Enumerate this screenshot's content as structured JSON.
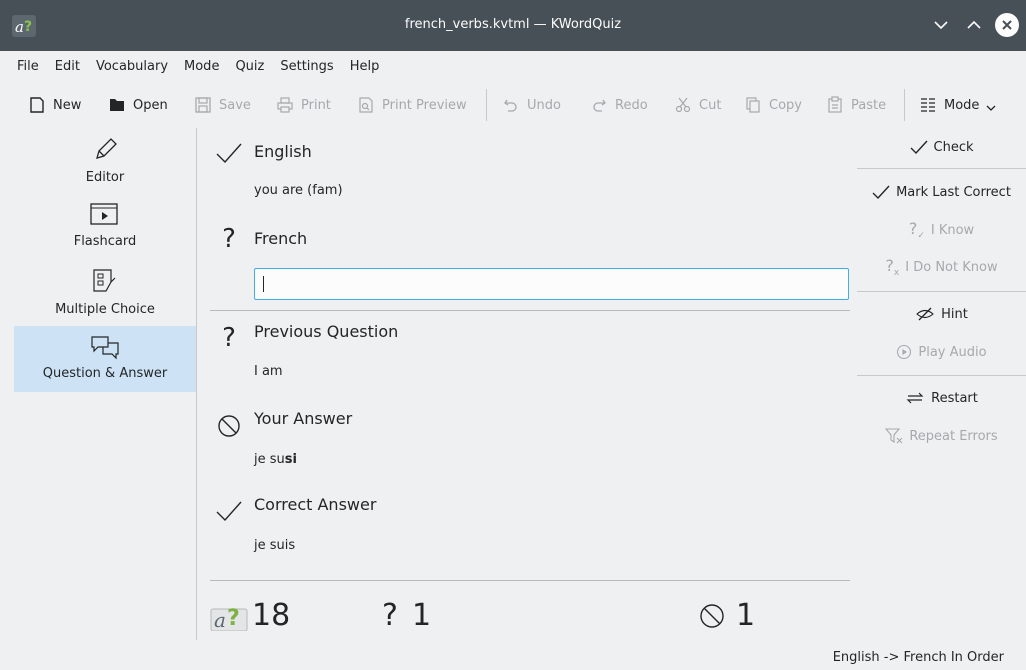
{
  "window": {
    "title": "french_verbs.kvtml — KWordQuiz"
  },
  "menubar": [
    "File",
    "Edit",
    "Vocabulary",
    "Mode",
    "Quiz",
    "Settings",
    "Help"
  ],
  "toolbar": {
    "new": "New",
    "open": "Open",
    "save": "Save",
    "print": "Print",
    "print_preview": "Print Preview",
    "undo": "Undo",
    "redo": "Redo",
    "cut": "Cut",
    "copy": "Copy",
    "paste": "Paste",
    "mode": "Mode"
  },
  "sidebar": {
    "items": [
      {
        "label": "Editor",
        "icon": "pencil-icon"
      },
      {
        "label": "Flashcard",
        "icon": "flashcard-icon"
      },
      {
        "label": "Multiple Choice",
        "icon": "multiple-choice-icon"
      },
      {
        "label": "Question & Answer",
        "icon": "question-answer-icon",
        "active": true
      }
    ]
  },
  "quiz": {
    "question_language": "English",
    "question_text": "you are (fam)",
    "answer_language": "French",
    "answer_value": "",
    "previous_question_title": "Previous Question",
    "previous_question_text": "I am",
    "your_answer_title": "Your Answer",
    "your_answer_prefix": "je su",
    "your_answer_wrong": "si",
    "correct_answer_title": "Correct Answer",
    "correct_answer_text": "je suis"
  },
  "score": {
    "total": "18",
    "unanswered": "1",
    "wrong": "1"
  },
  "actions": {
    "check": "Check",
    "mark_last_correct": "Mark Last Correct",
    "i_know": "I Know",
    "i_do_not_know": "I Do Not Know",
    "hint": "Hint",
    "play_audio": "Play Audio",
    "restart": "Restart",
    "repeat_errors": "Repeat Errors"
  },
  "status": {
    "mode_text": "English -> French In Order"
  },
  "colors": {
    "titlebar": "#475057",
    "accent": "#3daee9",
    "active_item": "#cde3f5",
    "disabled_text": "#a6a9ab"
  }
}
